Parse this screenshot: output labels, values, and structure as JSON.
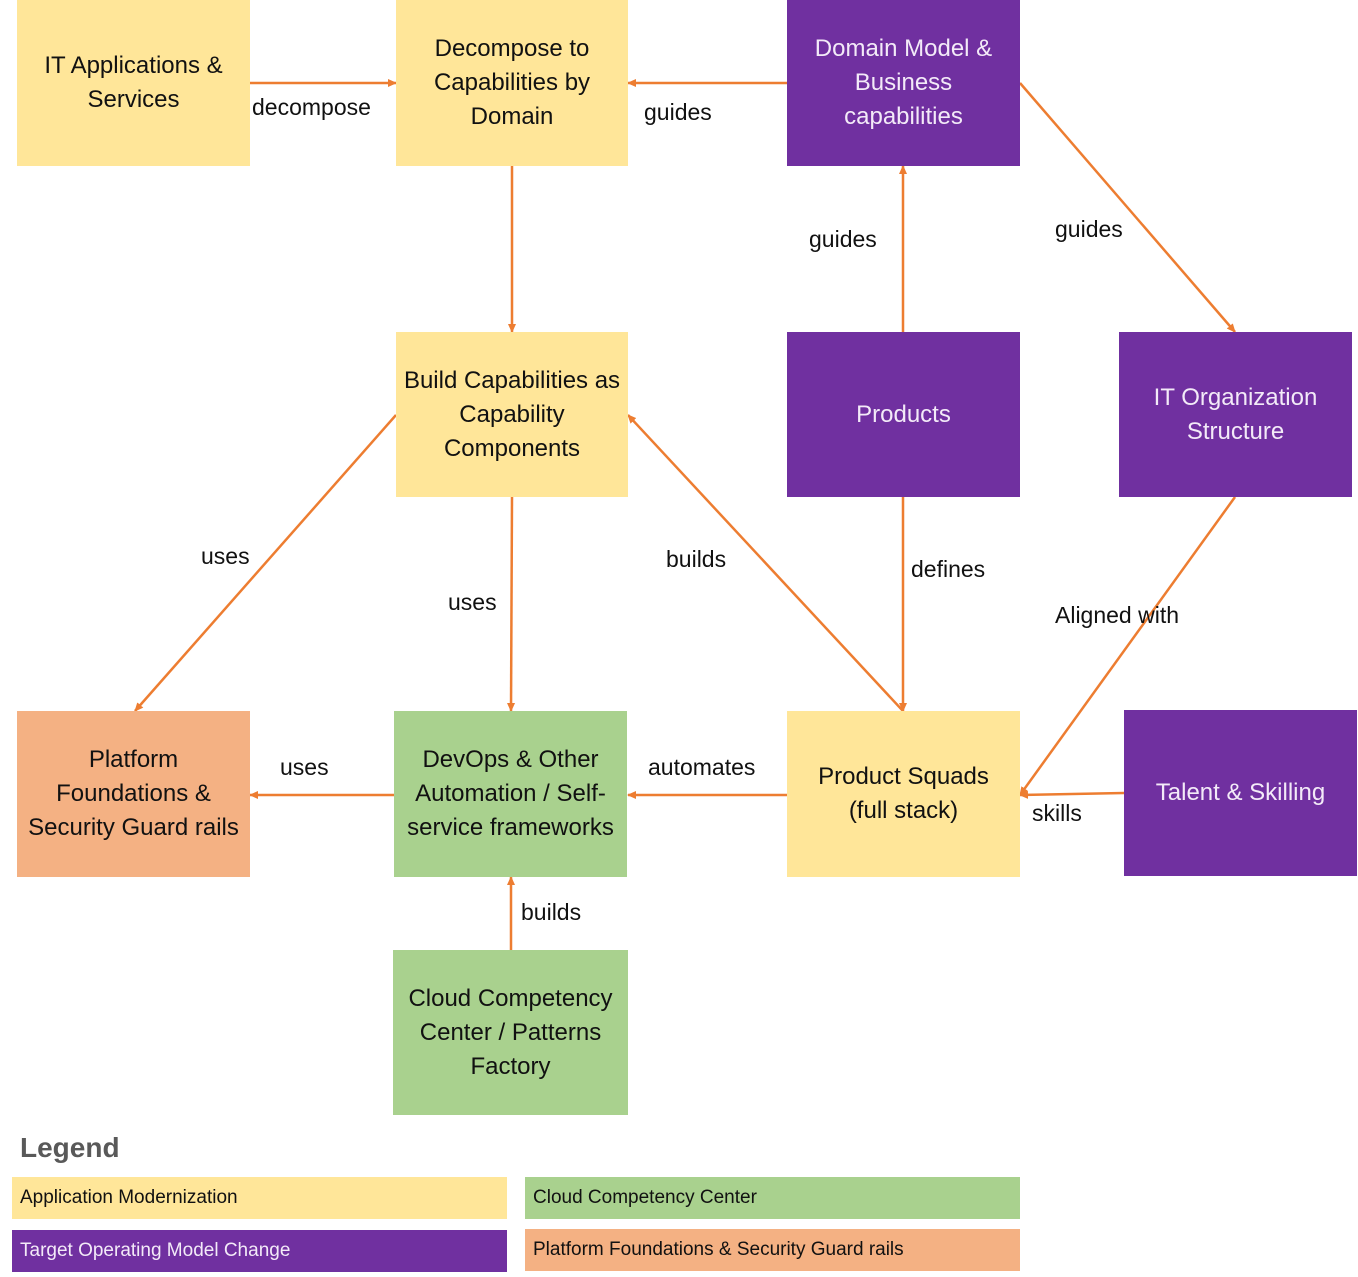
{
  "colors": {
    "app_modernization": "#FFE699",
    "target_operating_model": "#7030A0",
    "cloud_competency": "#A9D18E",
    "platform_foundations": "#F4B183",
    "arrow": "#ED7D31"
  },
  "nodes": {
    "it_apps": "IT Applications & Services",
    "decompose": "Decompose to Capabilities by Domain",
    "domain_model": "Domain Model & Business capabilities",
    "build_capabilities": "Build Capabilities as Capability Components",
    "products": "Products",
    "it_org": "IT Organization Structure",
    "platform": "Platform Foundations & Security Guard rails",
    "devops": "DevOps & Other Automation / Self-service frameworks",
    "squads": "Product Squads (full stack)",
    "talent": "Talent & Skilling",
    "cloud_cc": "Cloud Competency Center / Patterns Factory"
  },
  "edges": [
    {
      "from": "it_apps",
      "to": "decompose",
      "label": "decompose"
    },
    {
      "from": "domain_model",
      "to": "decompose",
      "label": "guides"
    },
    {
      "from": "decompose",
      "to": "build_capabilities",
      "label": ""
    },
    {
      "from": "products",
      "to": "domain_model",
      "label": "guides"
    },
    {
      "from": "domain_model",
      "to": "it_org",
      "label": "guides"
    },
    {
      "from": "build_capabilities",
      "to": "platform",
      "label": "uses"
    },
    {
      "from": "build_capabilities",
      "to": "devops",
      "label": "uses"
    },
    {
      "from": "squads",
      "to": "build_capabilities",
      "label": "builds"
    },
    {
      "from": "products",
      "to": "squads",
      "label": "defines"
    },
    {
      "from": "it_org",
      "to": "squads",
      "label": "Aligned with"
    },
    {
      "from": "talent",
      "to": "squads",
      "label": "skills"
    },
    {
      "from": "squads",
      "to": "devops",
      "label": "automates"
    },
    {
      "from": "devops",
      "to": "platform",
      "label": "uses"
    },
    {
      "from": "cloud_cc",
      "to": "devops",
      "label": "builds"
    }
  ],
  "legend": {
    "title": "Legend",
    "items": [
      "Application Modernization",
      "Cloud Competency Center",
      "Target Operating Model Change",
      "Platform Foundations & Security Guard rails"
    ]
  }
}
